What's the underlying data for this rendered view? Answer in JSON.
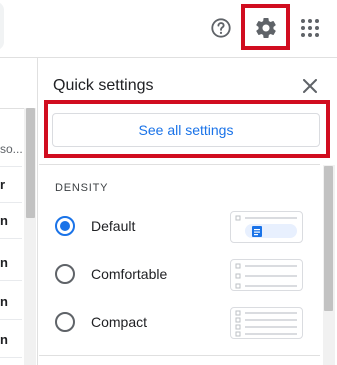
{
  "header": {
    "help_icon": "help-circle-icon",
    "settings_icon": "gear-icon",
    "apps_icon": "apps-grid-icon"
  },
  "email_list": {
    "rows": [
      "so...",
      "r",
      "n",
      "n",
      "n",
      "n",
      "o"
    ]
  },
  "quick_settings": {
    "title": "Quick settings",
    "close_icon": "close-icon",
    "see_all_label": "See all settings",
    "density": {
      "heading": "DENSITY",
      "options": [
        {
          "label": "Default",
          "selected": true
        },
        {
          "label": "Comfortable",
          "selected": false
        },
        {
          "label": "Compact",
          "selected": false
        }
      ]
    }
  },
  "colors": {
    "accent": "#1a73e8",
    "highlight": "#d10d1f",
    "text": "#202124",
    "icon": "#5f6368"
  }
}
